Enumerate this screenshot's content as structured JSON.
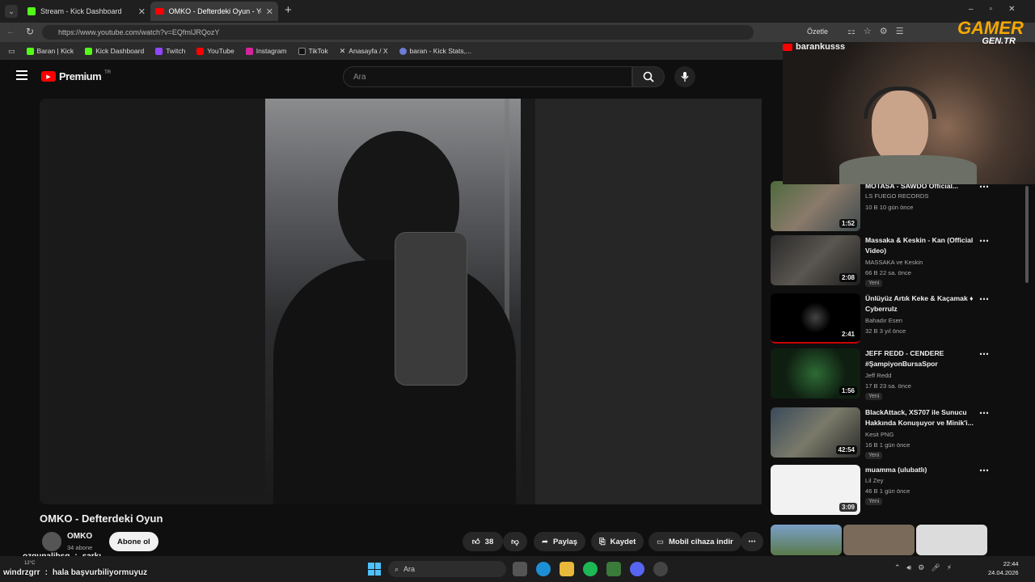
{
  "browser": {
    "tabs": [
      {
        "title": "Stream - Kick Dashboard",
        "active": false
      },
      {
        "title": "OMKO - Defterdeki Oyun - YouTube",
        "active": true
      }
    ],
    "url": "https://www.youtube.com/watch?v=EQfmlJRQozY",
    "summary_label": "Özetle",
    "bookmarks": [
      "Baran | Kick",
      "Kick Dashboard",
      "Twitch",
      "YouTube",
      "Instagram",
      "TikTok",
      "Anasayfa / X",
      "baran - Kick Stats,..."
    ]
  },
  "youtube": {
    "logo": "Premium",
    "logo_region": "TR",
    "search_placeholder": "Ara",
    "video": {
      "title": "OMKO - Defterdeki Oyun",
      "channel": "OMKO",
      "subscribers": "34 abone",
      "subscribe_label": "Abone ol",
      "likes": "38",
      "share_label": "Paylaş",
      "save_label": "Kaydet",
      "download_label": "Mobil cihaza indir"
    },
    "recommendations": [
      {
        "title": "MOTASA - SAWDO Official...",
        "channel": "LS FUEGO RECORDS",
        "meta": "10 B   10 gün önce",
        "duration": "1:52",
        "new": false
      },
      {
        "title": "Massaka & Keskin - Kan (Official Video)",
        "channel": "MASSAKA ve Keskin",
        "meta": "66 B   22 sa. önce",
        "duration": "2:08",
        "new": true
      },
      {
        "title": "Ünlüyüz Artık Keke & Kaçamak ♦ Cyberrulz",
        "channel": "Bahadır Esen",
        "meta": "32 B   3 yıl önce",
        "duration": "2:41",
        "new": false
      },
      {
        "title": "JEFF REDD - CENDERE #ŞampiyonBursaSpor",
        "channel": "Jeff Redd",
        "meta": "17 B   23 sa. önce",
        "duration": "1:56",
        "new": true
      },
      {
        "title": "BlackAttack, XS707 ile Sunucu Hakkında Konuşuyor ve Minik'i...",
        "channel": "Kesit PNG",
        "meta": "16 B   1 gün önce",
        "duration": "42:54",
        "new": true
      },
      {
        "title": "muamma (ulubatlı)",
        "channel": "Lil Zey",
        "meta": "46 B   1 gün önce",
        "duration": "3:09",
        "new": true
      }
    ],
    "new_badge": "Yeni"
  },
  "overlay": {
    "streamer": "barankusss",
    "brand": "GAMER",
    "brand_sub": "GEN.TR",
    "chat": [
      {
        "user": "ozgunalibsg",
        "text": "şarkı"
      },
      {
        "user": "windrzgrr",
        "text": "hala başvurbiliyormuyuz"
      }
    ]
  },
  "taskbar": {
    "search_label": "Ara",
    "weather": "12°C",
    "time": "22:44",
    "date": "24.04.2026"
  },
  "colors": {
    "accent_red": "#ff0000",
    "kick_green": "#53fc18",
    "bg": "#0f0f0f"
  }
}
